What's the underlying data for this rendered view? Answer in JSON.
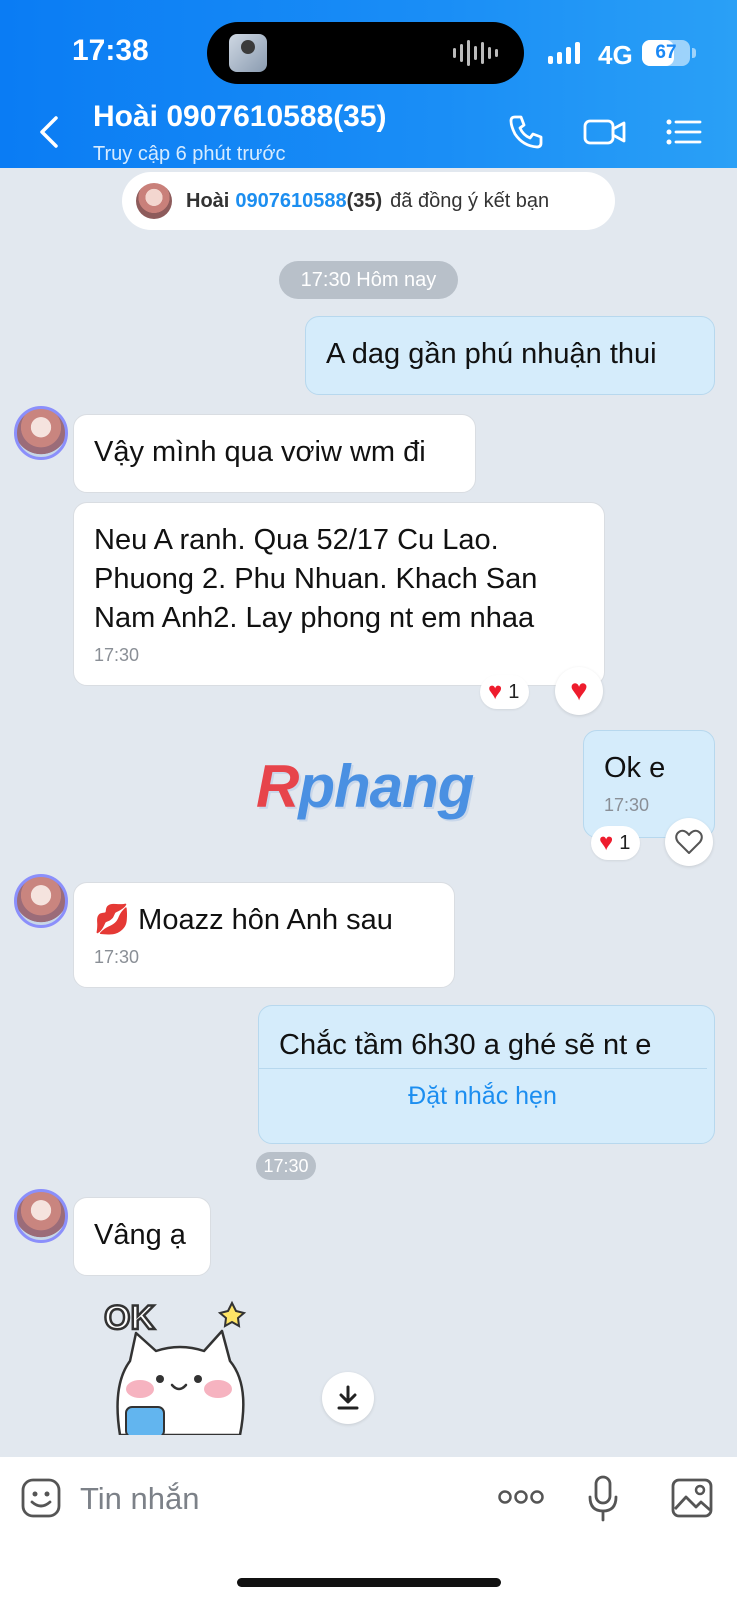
{
  "status_bar": {
    "time": "17:38",
    "network": "4G",
    "battery": "67",
    "battery_level": 0.67
  },
  "header": {
    "contact_name": "Hoài 0907610588(35)",
    "status": "Truy cập 6 phút trước"
  },
  "friend_notice": {
    "name": "Hoài",
    "phone": "0907610588",
    "count": "(35)",
    "text": "đã đồng ý kết bạn"
  },
  "time_separator": "17:30 Hôm nay",
  "messages": [
    {
      "from": "me",
      "text": "A dag gần phú nhuận thui"
    },
    {
      "from": "them",
      "text": "Vậy mình qua vơiw wm đi"
    },
    {
      "from": "them",
      "text": "Neu A ranh. Qua 52/17 Cu Lao.\nPhuong 2. Phu Nhuan. Khach San\nNam Anh2. Lay phong nt em nhaa",
      "time": "17:30",
      "reaction_count": "1"
    },
    {
      "from": "me",
      "text": "Ok e",
      "time": "17:30",
      "reaction_count": "1"
    },
    {
      "from": "them",
      "text": "💋  Moazz hôn Anh sau",
      "time": "17:30"
    },
    {
      "from": "me",
      "text": "Chắc tầm 6h30 a ghé sẽ nt e",
      "action": "Đặt nhắc hẹn",
      "time": "17:30"
    },
    {
      "from": "them",
      "text": "Vâng ạ"
    }
  ],
  "sticker": {
    "label": "OK"
  },
  "watermark": {
    "r": "R",
    "rest": "phang"
  },
  "input": {
    "placeholder": "Tin nhắn"
  },
  "icons": {
    "back": "chevron-left-icon",
    "call": "phone-icon",
    "video": "video-camera-icon",
    "menu": "list-menu-icon",
    "emoji": "emoji-icon",
    "more": "more-dots-icon",
    "mic": "microphone-icon",
    "image": "image-icon",
    "download": "download-icon",
    "heart": "heart-icon"
  },
  "colors": {
    "header": "#0a7cf4",
    "accent": "#1c8ef0",
    "my_bubble": "#d5ecfb",
    "background": "#e2e8ef",
    "heart": "#ee1c2d"
  }
}
